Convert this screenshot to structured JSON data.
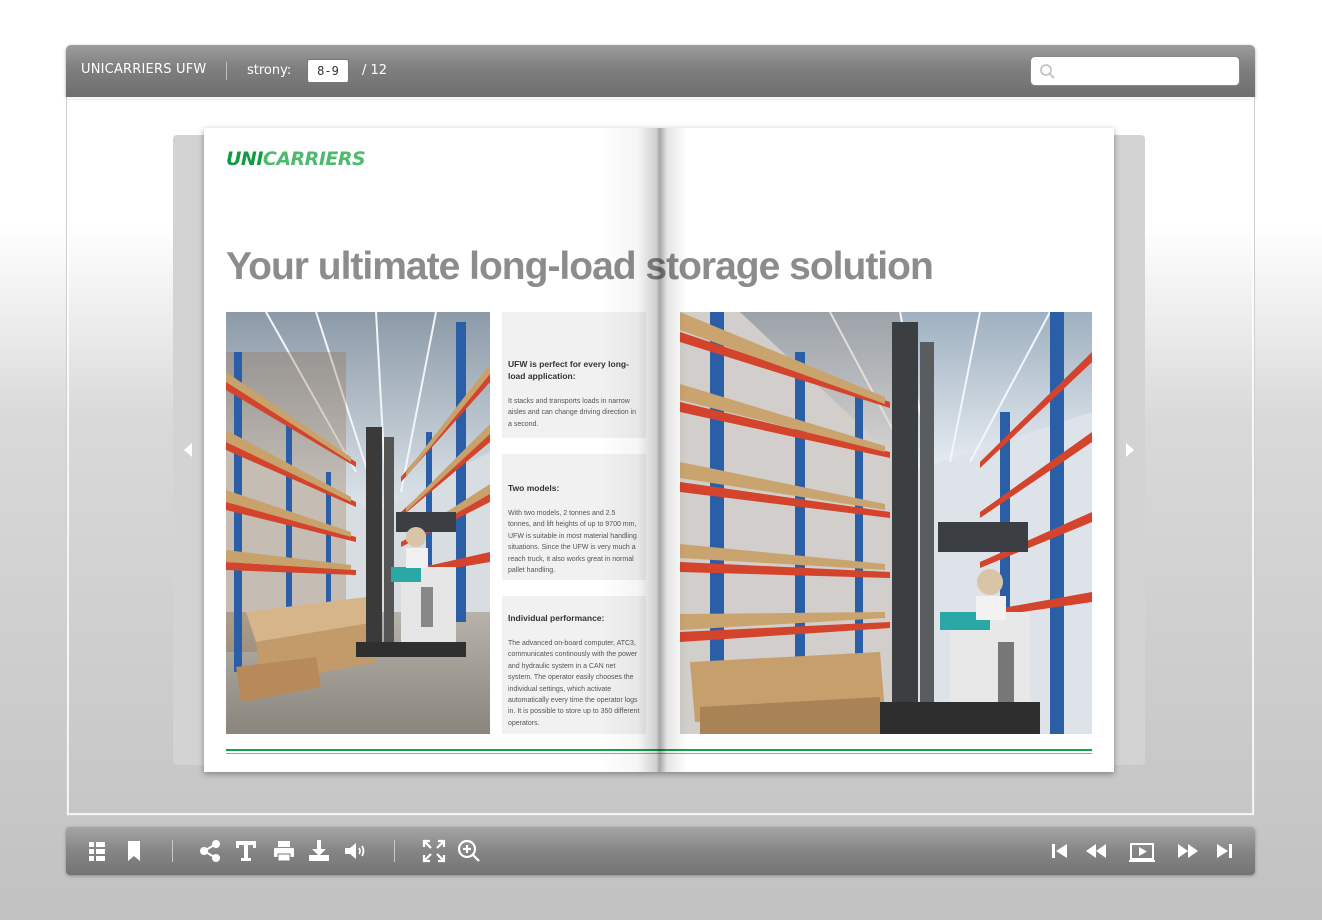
{
  "topbar": {
    "title": "UNICARRIERS UFW",
    "pages_label": "strony:",
    "page_value": "8-9",
    "total_pages": "/ 12",
    "search_placeholder": ""
  },
  "spread": {
    "logo_uni": "UNI",
    "logo_carriers": "CARRIERS",
    "headline": "Your ultimate long-load storage solution",
    "blocks": [
      {
        "heading": "UFW is perfect for every long-load application:",
        "body": "It stacks and transports loads in narrow aisles and can change driving direction in a second."
      },
      {
        "heading": "Two models:",
        "body": "With two models, 2 tonnes and 2.5 tonnes, and lift heights of up to 9700 mm, UFW is suitable in most material handling situations. Since the UFW is very much a reach truck, it also works great in normal pallet handling."
      },
      {
        "heading": "Individual performance:",
        "body": "The advanced on-board computer, ATC3, communicates continously with the power and hydraulic system in a CAN net system. The operator easily chooses the individual settings, which activate automatically every time the operator logs in. It is possible to store up to 350 different operators."
      }
    ]
  },
  "bottombar": {
    "left_icons": [
      "thumbnails-icon",
      "bookmark-icon"
    ],
    "middle_icons": [
      "share-icon",
      "text-icon",
      "print-icon",
      "download-icon",
      "sound-icon"
    ],
    "view_icons": [
      "fullscreen-icon",
      "zoom-in-icon"
    ],
    "right_icons": [
      "first-page-icon",
      "previous-page-icon",
      "slideshow-icon",
      "next-page-icon",
      "last-page-icon"
    ]
  },
  "colors": {
    "brand_green": "#109a45",
    "headline_gray": "#8c8c8c",
    "toolbar_gray": "#7f7f7f"
  }
}
